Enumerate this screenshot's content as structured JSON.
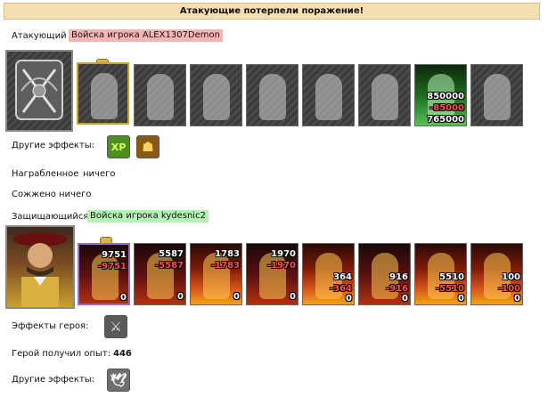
{
  "result": {
    "banner": "Атакующие потерпели поражение!"
  },
  "attacker": {
    "label": "Атакующий",
    "army_name": "Войска игрока ALEX1307Demon",
    "units": [
      {
        "icon": "knight-unit-icon"
      },
      {
        "icon": "crusader-unit-icon"
      },
      {
        "icon": "spearman-unit-icon"
      },
      {
        "icon": "griffin-unit-icon"
      },
      {
        "icon": "archer-unit-icon"
      },
      {
        "icon": "priestess-unit-icon"
      },
      {
        "icon": "green-unit-icon",
        "total": "850000",
        "loss": "-85000",
        "left": "765000"
      },
      {
        "icon": "monk-unit-icon"
      }
    ],
    "other_effects_label": "Другие эффекты:",
    "effects": [
      {
        "icon": "xp-icon",
        "text": "XP"
      },
      {
        "icon": "gold-pouch-icon",
        "text": "☗"
      }
    ],
    "awarded_label": "Награбленное",
    "awarded_value": "ничего",
    "burned_label": "Сожжено",
    "burned_value": "ничего"
  },
  "defender": {
    "label": "Защищающийся",
    "army_name": "Войска игрока kydesnic2",
    "units": [
      {
        "icon": "demon-unit-icon",
        "total": "9751",
        "loss": "-9751",
        "left": "0"
      },
      {
        "icon": "imp-unit-icon",
        "total": "5587",
        "loss": "-5587",
        "left": "0"
      },
      {
        "icon": "hellhound-unit-icon",
        "total": "1783",
        "loss": "-1783",
        "left": "0"
      },
      {
        "icon": "horned-demon-unit-icon",
        "total": "1970",
        "loss": "-1970",
        "left": "0"
      },
      {
        "icon": "fire-beast-unit-icon",
        "total": "364",
        "loss": "-364",
        "left": "0"
      },
      {
        "icon": "pit-fiend-unit-icon",
        "total": "916",
        "loss": "-916",
        "left": "0"
      },
      {
        "icon": "succubus-unit-icon",
        "total": "5510",
        "loss": "-5510",
        "left": "0"
      },
      {
        "icon": "arch-devil-unit-icon",
        "total": "100",
        "loss": "-100",
        "left": "0"
      }
    ],
    "hero_effects_label": "Эффекты героя:",
    "hero_effect_icon": "sword-icon",
    "xp_label": "Герой получил опыт:",
    "xp_value": "446",
    "other_effects_label": "Другие эффекты:",
    "other_effect_icon": "dove-icon"
  },
  "colors": {
    "banner_bg": "#f5dfb2",
    "attacker_tag": "#f6b5b5",
    "defender_tag": "#b4f2b4",
    "loss": "#ff5050"
  }
}
